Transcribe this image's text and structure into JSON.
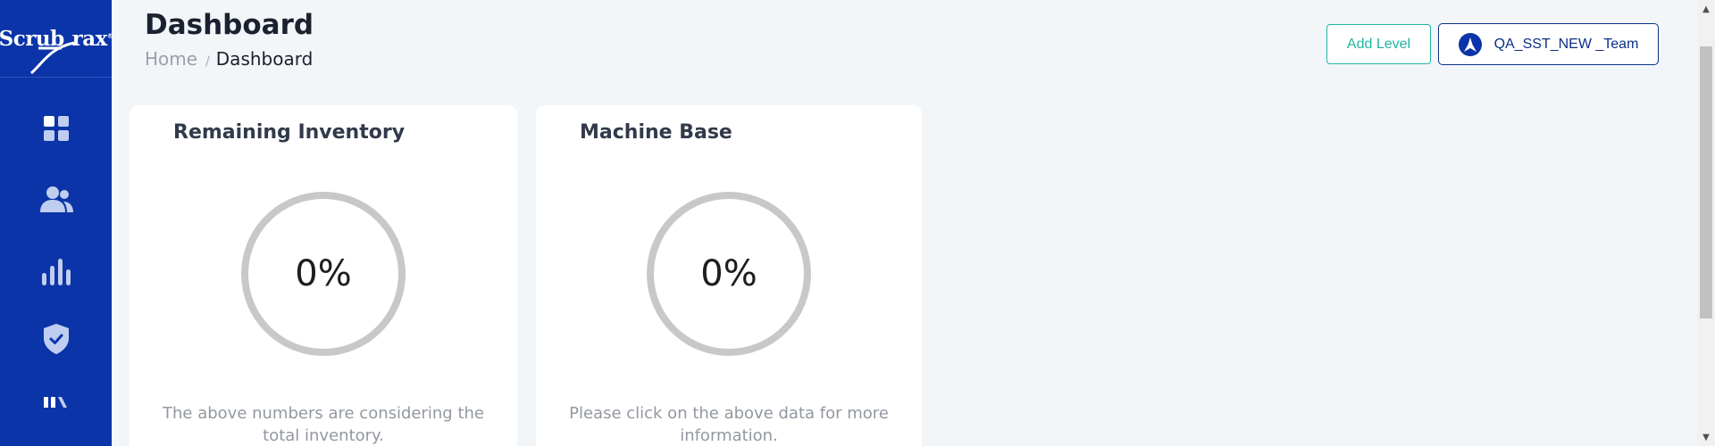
{
  "sidebar": {
    "logo_text": "Scrub",
    "logo_text2": "rax",
    "logo_tm": "®",
    "nav": [
      {
        "icon": "dashboard-grid-icon"
      },
      {
        "icon": "users-icon"
      },
      {
        "icon": "bar-chart-icon"
      },
      {
        "icon": "shield-check-icon"
      },
      {
        "icon": "library-icon"
      }
    ],
    "colors": {
      "background": "#0a34a8",
      "icon": "#bfcdf0",
      "icon_active": "#ffffff"
    }
  },
  "header": {
    "title": "Dashboard",
    "breadcrumb": {
      "home": "Home",
      "separator": "/",
      "current": "Dashboard"
    },
    "add_level_label": "Add Level",
    "team_label": "QA_SST_NEW _Team"
  },
  "cards": [
    {
      "title": "Remaining Inventory",
      "value": "0%",
      "percent": 0,
      "note": "The above numbers are considering the total inventory."
    },
    {
      "title": "Machine Base",
      "value": "0%",
      "percent": 0,
      "note": "Please click on the above data for more information."
    }
  ],
  "colors": {
    "accent_teal": "#21b5a2",
    "brand_navy": "#0b2f86",
    "ring_gray": "#c8c8c8"
  }
}
